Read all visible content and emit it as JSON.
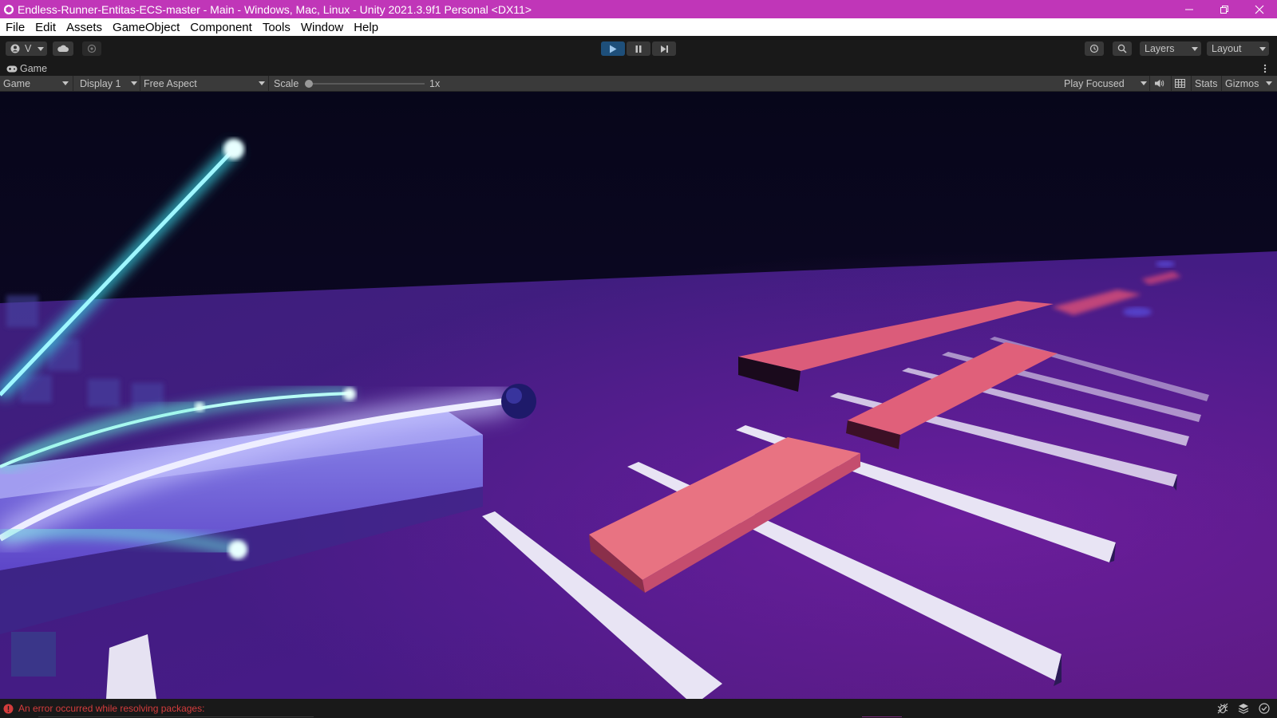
{
  "window": {
    "title": "Endless-Runner-Entitas-ECS-master - Main - Windows, Mac, Linux - Unity 2021.3.9f1 Personal <DX11>",
    "titlebar_color": "#c036b8"
  },
  "menu": {
    "items": [
      "File",
      "Edit",
      "Assets",
      "GameObject",
      "Component",
      "Tools",
      "Window",
      "Help"
    ]
  },
  "toolbar": {
    "account_label": "V",
    "layers_label": "Layers",
    "layout_label": "Layout",
    "play_color": "#1e4f7a"
  },
  "tab": {
    "label": "Game"
  },
  "gamebar": {
    "view_label": "Game",
    "display_label": "Display 1",
    "aspect_label": "Free Aspect",
    "scale_label": "Scale",
    "scale_value": "1x",
    "play_mode_label": "Play Focused",
    "stats_label": "Stats",
    "gizmos_label": "Gizmos"
  },
  "status": {
    "message": "An error occurred while resolving packages:",
    "error_color": "#d33c3c"
  },
  "icons": [
    "unity-logo-icon",
    "minimize-icon",
    "restore-icon",
    "close-icon",
    "account-icon",
    "cloud-icon",
    "collab-icon",
    "play-icon",
    "pause-icon",
    "step-icon",
    "history-icon",
    "search-icon",
    "gamepad-icon",
    "more-icon",
    "audio-icon",
    "stats-grid-icon",
    "error-icon",
    "bug-icon",
    "layers-status-icon",
    "check-icon"
  ]
}
